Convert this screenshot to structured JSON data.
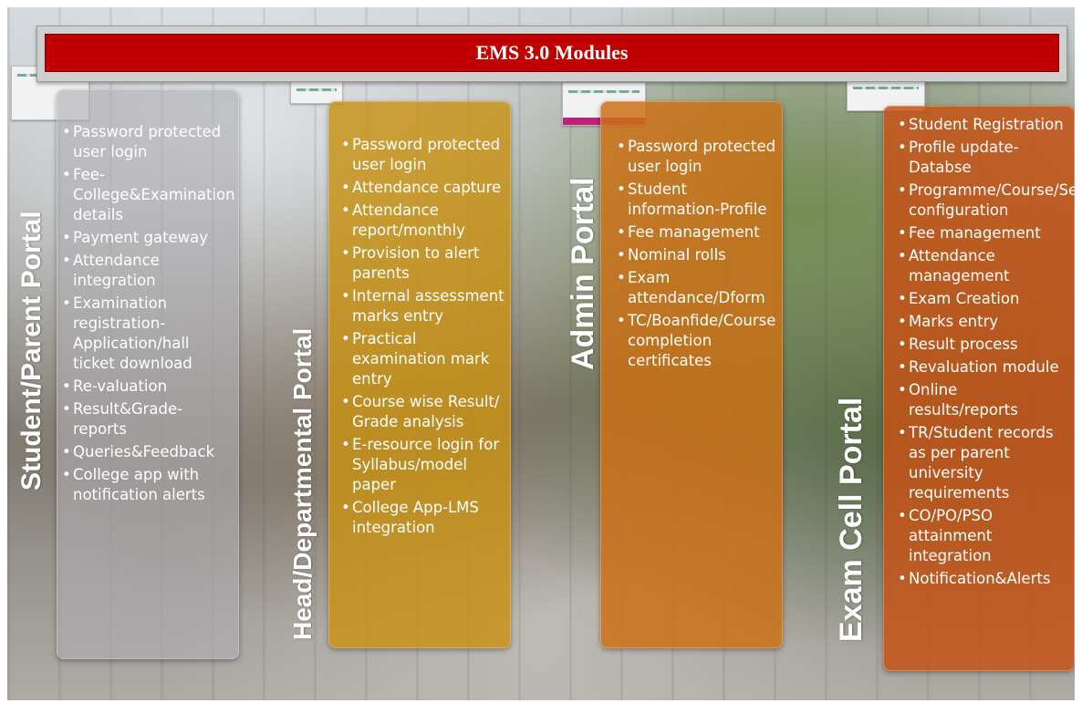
{
  "title": "EMS 3.0 Modules",
  "portals": [
    {
      "label": "Student/Parent Portal",
      "items": [
        "Password protected user login",
        "Fee-College&Examination details",
        "Payment gateway",
        "Attendance integration",
        "Examination registration-Application/hall ticket download",
        "Re-valuation",
        "Result&Grade-reports",
        "Queries&Feedback",
        "College app with notification alerts"
      ]
    },
    {
      "label": "Head/Departmental Portal",
      "items": [
        "Password protected user login",
        "Attendance capture",
        "Attendance report/monthly",
        "Provision to alert parents",
        "Internal assessment marks entry",
        "Practical examination mark entry",
        "Course wise Result/ Grade analysis",
        "E-resource login for Syllabus/model paper",
        "College App-LMS integration"
      ]
    },
    {
      "label": "Admin Portal",
      "items": [
        "Password protected user login",
        "Student information-Profile",
        "Fee management",
        "Nominal rolls",
        "Exam attendance/Dform",
        "TC/Boanfide/Course completion certificates"
      ]
    },
    {
      "label": "Exam Cell Portal",
      "items": [
        "Student Registration",
        "Profile update-Databse",
        "Programme/Course/Semester configuration",
        "Fee management",
        "Attendance management",
        "Exam Creation",
        "Marks entry",
        "Result process",
        "Revaluation module",
        "Online results/reports",
        "TR/Student records as per parent university requirements",
        "CO/PO/PSO attainment integration",
        "Notification&Alerts"
      ]
    }
  ]
}
